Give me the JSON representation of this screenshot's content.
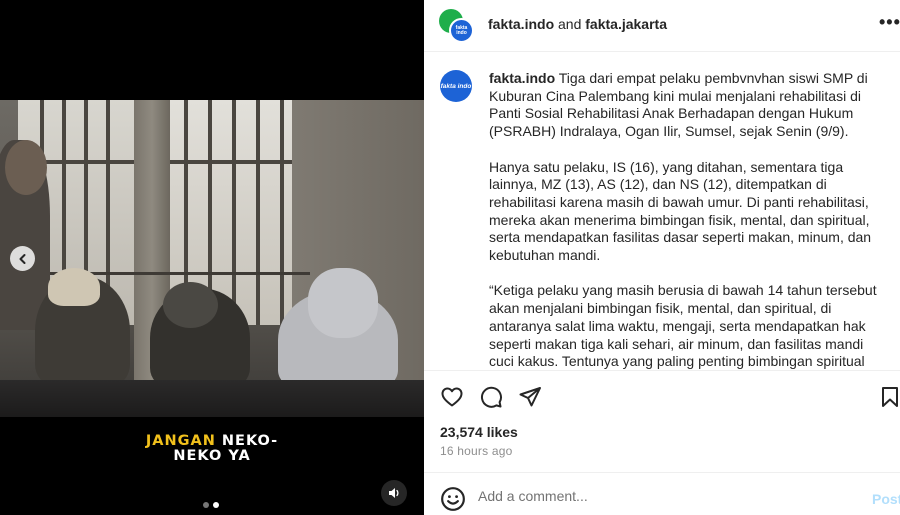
{
  "media": {
    "caption_line1_highlight": "JANGAN",
    "caption_line1_rest": " NEKO-",
    "caption_line2": "NEKO YA",
    "highlight_color": "#f2c11c",
    "slide_count": 2,
    "active_slide": 2
  },
  "header": {
    "author1": "fakta.indo",
    "and_text": " and ",
    "author2": "fakta.jakarta",
    "avatar_small_text": "fakta indo",
    "more_label": "•••"
  },
  "comment": {
    "avatar_text": "fakta indo",
    "username": "fakta.indo",
    "paragraph1": " Tiga dari empat pelaku pembvnvhan siswi SMP di Kuburan Cina Palembang kini mulai menjalani rehabilitasi di Panti Sosial Rehabilitasi Anak Berhadapan dengan Hukum (PSRABH) Indralaya, Ogan Ilir, Sumsel, sejak Senin (9/9).",
    "paragraph2": "Hanya satu pelaku, IS (16), yang ditahan, sementara tiga lainnya, MZ (13), AS (12), dan NS (12), ditempatkan di rehabilitasi karena masih di bawah umur. Di panti rehabilitasi, mereka akan menerima bimbingan fisik, mental, dan spiritual, serta mendapatkan fasilitas dasar seperti makan, minum, dan kebutuhan mandi.",
    "paragraph3": "“Ketiga pelaku yang masih berusia di bawah 14 tahun tersebut akan menjalani bimbingan fisik, mental, dan spiritual, di antaranya salat lima waktu, mengaji, serta mendapatkan hak seperti makan tiga kali sehari, air minum, dan fasilitas mandi cuci kakus. Tentunya yang paling penting bimbingan spiritual agar"
  },
  "post_stats": {
    "likes": "23,574 likes",
    "time_ago": "16 hours ago"
  },
  "add_comment": {
    "placeholder": "Add a comment...",
    "post_label": "Post"
  },
  "colors": {
    "brand_blue": "#1d63d6",
    "brand_green": "#1fae4b",
    "post_disabled": "#b2dffc"
  }
}
